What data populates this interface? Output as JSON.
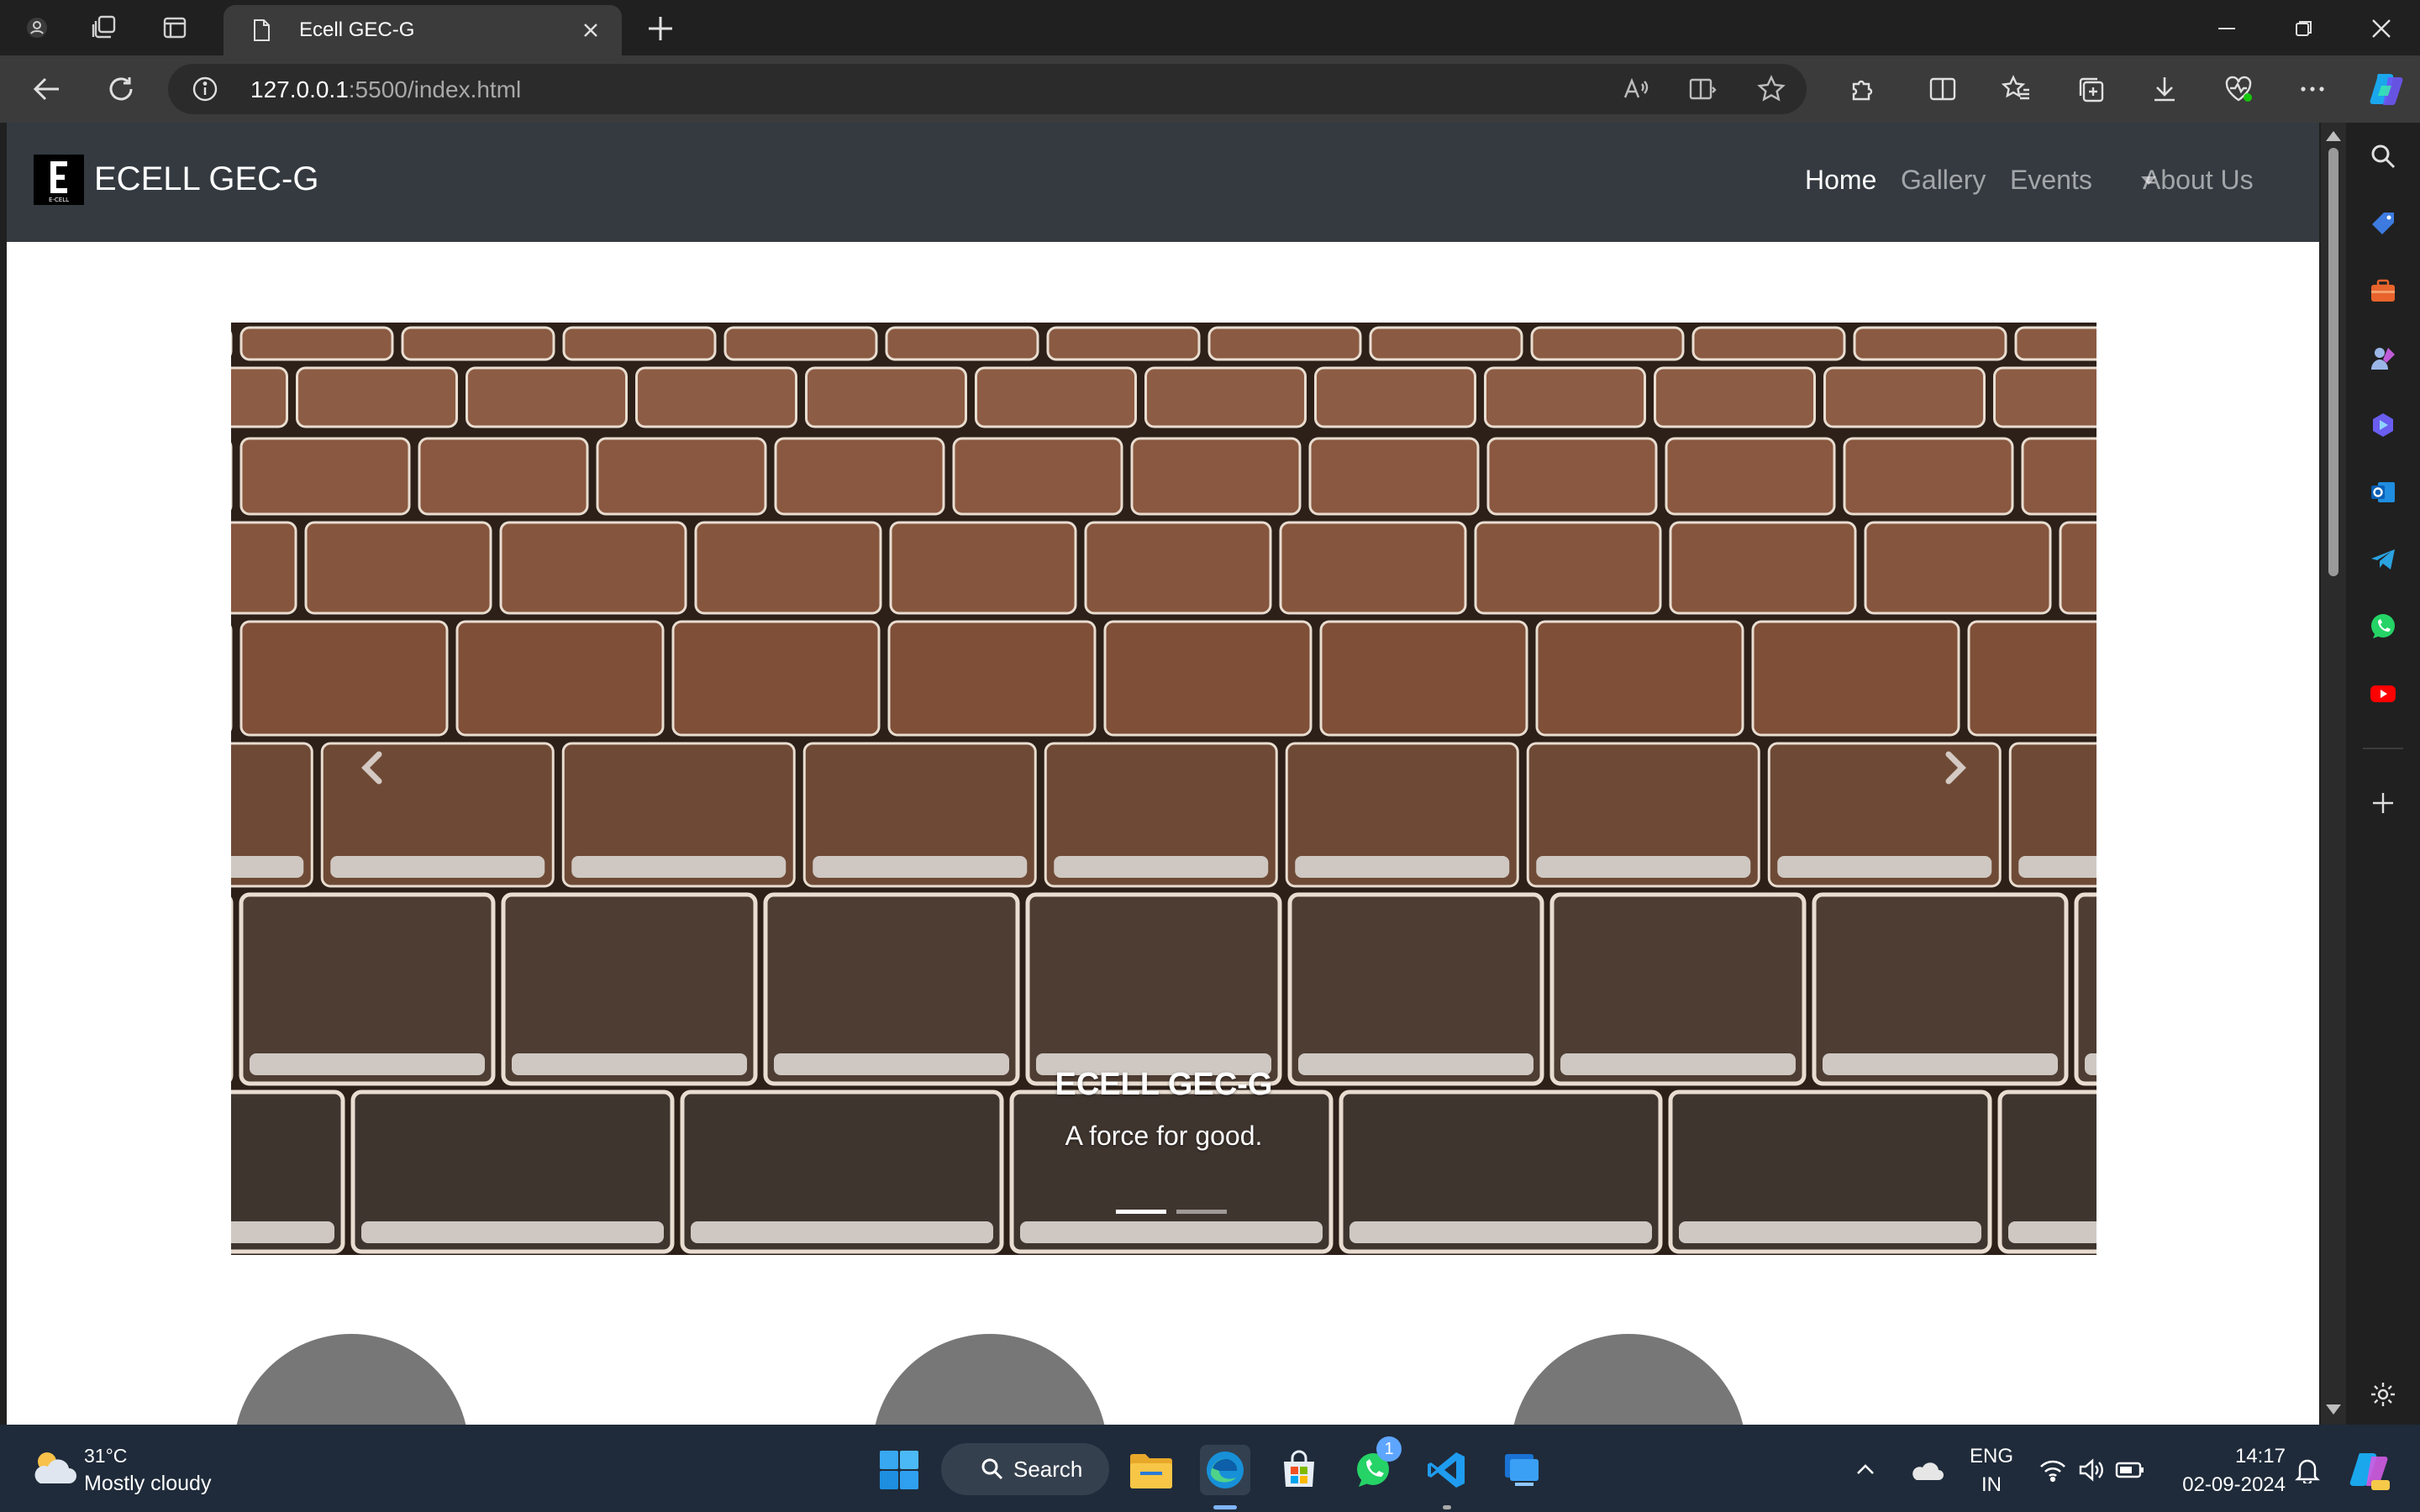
{
  "browser": {
    "tab_title": "Ecell GEC-G",
    "url_host": "127.0.0.1",
    "url_path": ":5500/index.html"
  },
  "site": {
    "brand": "ECELL GEC-G",
    "logo_text": "E-CELL",
    "nav": [
      {
        "label": "Home",
        "active": true
      },
      {
        "label": "Gallery"
      },
      {
        "label": "Events"
      },
      {
        "label": "About Us"
      }
    ],
    "carousel": {
      "caption_title": "ECELL GEC-G",
      "caption_text": "A force for good.",
      "slide_count": 2,
      "active_slide": 1
    }
  },
  "taskbar": {
    "weather_temp": "31°C",
    "weather_desc": "Mostly cloudy",
    "search_label": "Search",
    "whatsapp_badge": "1",
    "lang_top": "ENG",
    "lang_bottom": "IN",
    "time": "14:17",
    "date": "02-09-2024"
  },
  "colors": {
    "navbar_bg": "#343a40",
    "edge_accent": "#4cc2ff",
    "taskbar_bg": "#1f2b3a"
  }
}
